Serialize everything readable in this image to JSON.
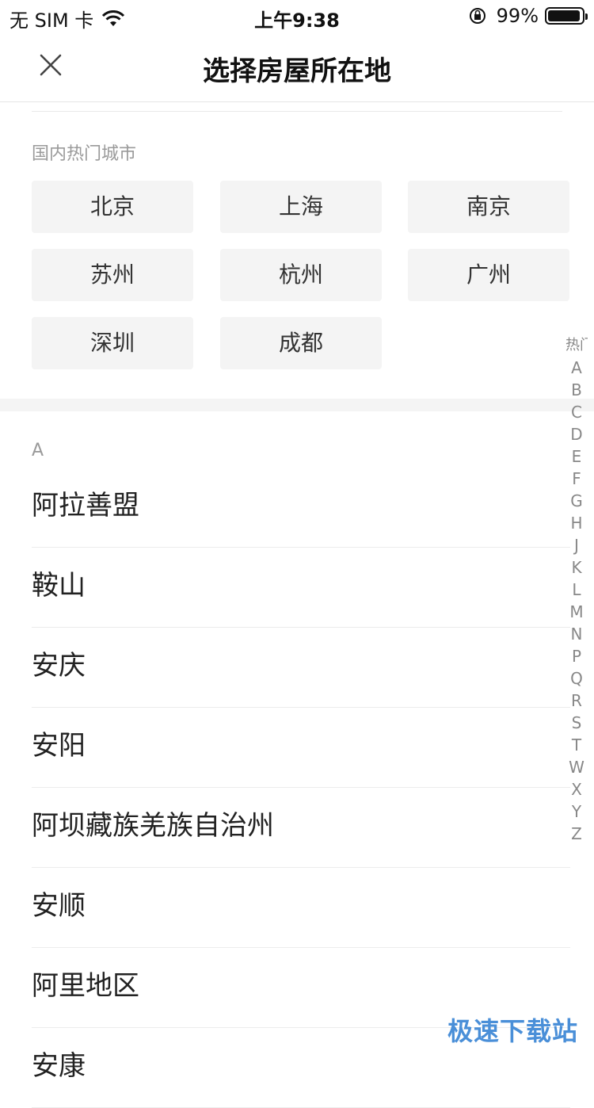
{
  "status_bar": {
    "carrier": "无 SIM 卡",
    "time": "上午9:38",
    "battery": "99%"
  },
  "nav": {
    "title": "选择房屋所在地",
    "close_icon": "close-icon"
  },
  "hot_cities": {
    "label": "国内热门城市",
    "items": [
      "北京",
      "上海",
      "南京",
      "苏州",
      "杭州",
      "广州",
      "深圳",
      "成都"
    ]
  },
  "list": {
    "section_header": "A",
    "items": [
      "阿拉善盟",
      "鞍山",
      "安庆",
      "安阳",
      "阿坝藏族羌族自治州",
      "安顺",
      "阿里地区",
      "安康"
    ]
  },
  "index_bar": [
    "热门",
    "A",
    "B",
    "C",
    "D",
    "E",
    "F",
    "G",
    "H",
    "J",
    "K",
    "L",
    "M",
    "N",
    "P",
    "Q",
    "R",
    "S",
    "T",
    "W",
    "X",
    "Y",
    "Z"
  ],
  "watermark": "极速下载站"
}
